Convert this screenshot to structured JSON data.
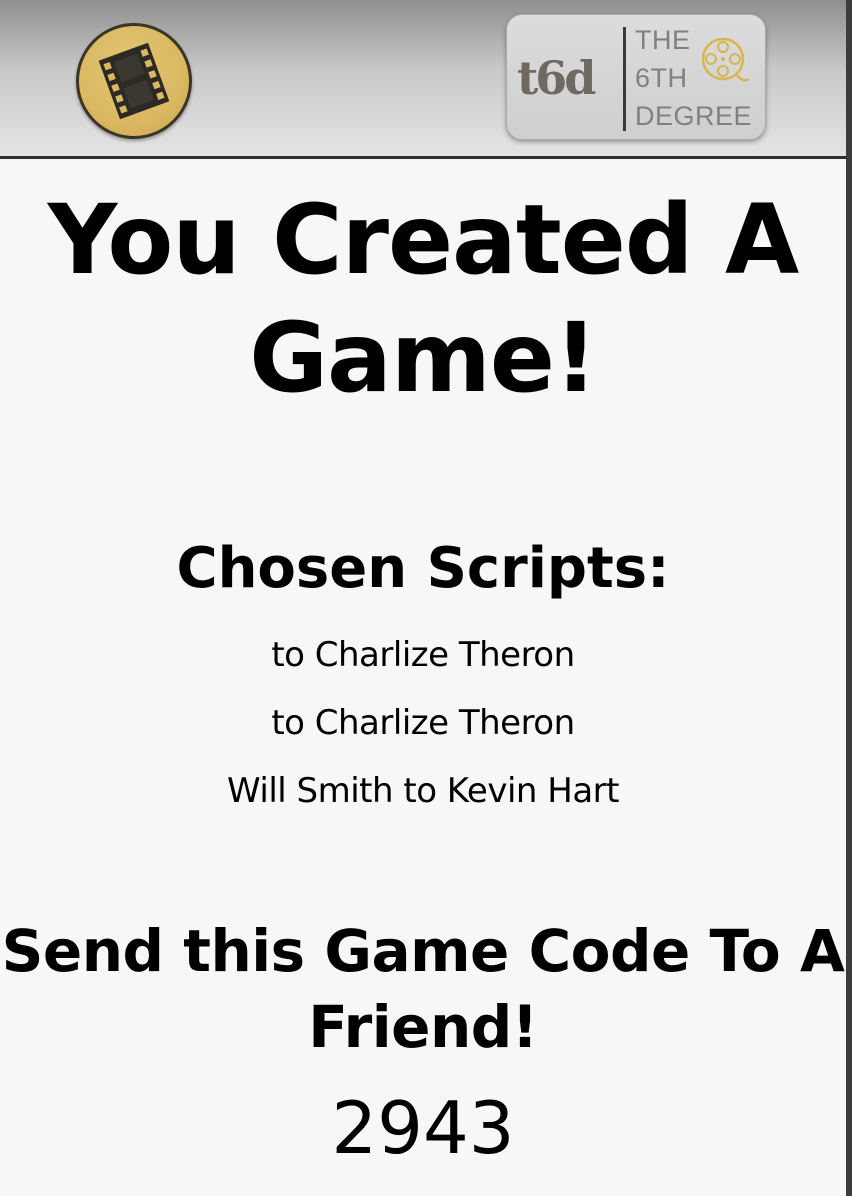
{
  "header": {
    "menu_icon": "film-strip-icon",
    "logo": {
      "mark": "t6d",
      "lines": [
        "THE",
        "6TH",
        "DEGREE"
      ],
      "reel_icon": "film-reel-icon"
    }
  },
  "colors": {
    "menu_button": "#d9b861",
    "logo_reel": "#d8b54e",
    "background": "#f9f6f6"
  },
  "main": {
    "title": "You Created A Game!",
    "scripts_heading": "Chosen Scripts:",
    "scripts": [
      "to Charlize Theron",
      "to Charlize Theron",
      "Will Smith to Kevin Hart"
    ],
    "send_heading": "Send this Game Code To A Friend!",
    "game_code": "2943"
  }
}
